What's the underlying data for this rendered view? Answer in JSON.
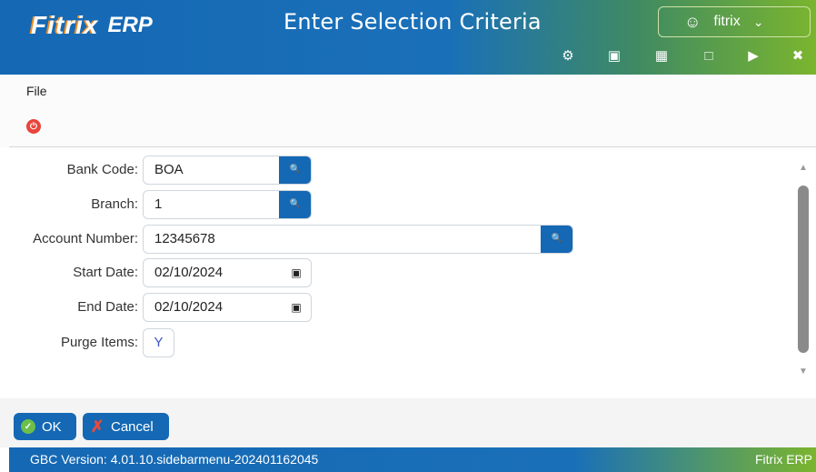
{
  "header": {
    "logo_text": "Fitrix",
    "logo_suffix": "ERP",
    "title": "Enter Selection Criteria",
    "user_name": "fitrix",
    "toolbar_icons": [
      "gear-icon",
      "chip-icon",
      "document-icon",
      "new-document-icon",
      "play-icon",
      "close-circle-icon"
    ]
  },
  "menu": {
    "file": "File"
  },
  "form": {
    "bank_code": {
      "label": "Bank Code:",
      "value": "BOA"
    },
    "branch": {
      "label": "Branch:",
      "value": "1"
    },
    "account_number": {
      "label": "Account Number:",
      "value": "12345678"
    },
    "start_date": {
      "label": "Start Date:",
      "value": "02/10/2024"
    },
    "end_date": {
      "label": "End Date:",
      "value": "02/10/2024"
    },
    "purge_items": {
      "label": "Purge Items:",
      "value": "Y"
    }
  },
  "buttons": {
    "ok": "OK",
    "cancel": "Cancel"
  },
  "status": {
    "version": "GBC Version: 4.01.10.sidebarmenu-202401162045",
    "brand": "Fitrix ERP"
  },
  "colors": {
    "primary": "#1468b4",
    "accent_green": "#7bb52e",
    "ok_green": "#6cc04a",
    "danger": "#e8453c"
  }
}
